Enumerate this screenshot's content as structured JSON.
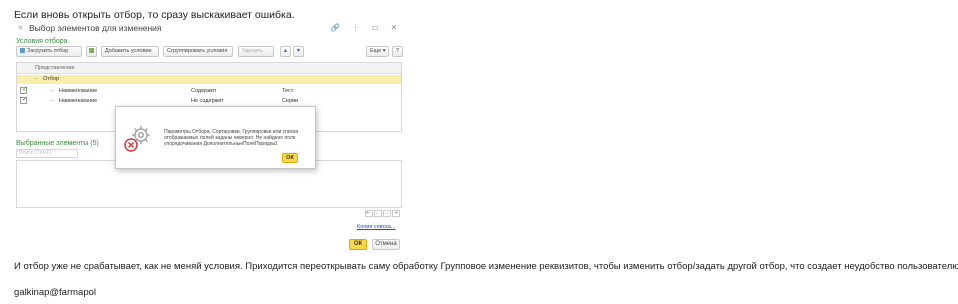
{
  "post": {
    "intro": "Если вновь открыть отбор, то сразу выскакивает ошибка.",
    "followup": "И отбор уже не срабатывает, как не меняй условия. Приходится переоткрывать саму обработку Групповое изменение реквизитов, чтобы изменить отбор/задать другой отбор, что создает неудобство пользователю.",
    "signature": "galkinap@farmapol"
  },
  "window": {
    "title": "Выбор элементов для изменения",
    "controls": "🔗 ⋮ ▭ ✕"
  },
  "filter_section": {
    "title": "Условия отбора",
    "toolbar": {
      "load_filter": "Загрузить отбор",
      "add_condition": "Добавить условие",
      "group_conditions": "Сгруппировать условия",
      "delete": "Удалить",
      "more": "Еще ▾",
      "help": "?"
    },
    "grid": {
      "header": "Представление",
      "group_row": "Отбор",
      "rows": [
        {
          "field": "Наименование",
          "condition": "Содержит",
          "value": "Тест"
        },
        {
          "field": "Наименование",
          "condition": "Не содержит",
          "value": "Серви"
        }
      ]
    }
  },
  "selected_section": {
    "title": "Выбранные элементы (5)",
    "search_placeholder": "Поиск (Ctrl+F)",
    "pager": [
      "⇤",
      "←",
      "→",
      "⇥"
    ],
    "more_link": "Копия списка..."
  },
  "footer": {
    "ok": "ОК",
    "cancel": "Отмена"
  },
  "error_dialog": {
    "message": "Параметры Отбора, Сортировки, Группировки или списки отображаемых полей заданы неверно: Не найдено поле упорядочивания ДополнительныеПолеПорядка1",
    "ok": "ОК"
  },
  "colors": {
    "section_title": "#3c8e3c",
    "selected_row": "#fbedab",
    "primary_button": "#fbd84a",
    "link": "#1a4fb8",
    "error_icon": "#d9363e"
  }
}
